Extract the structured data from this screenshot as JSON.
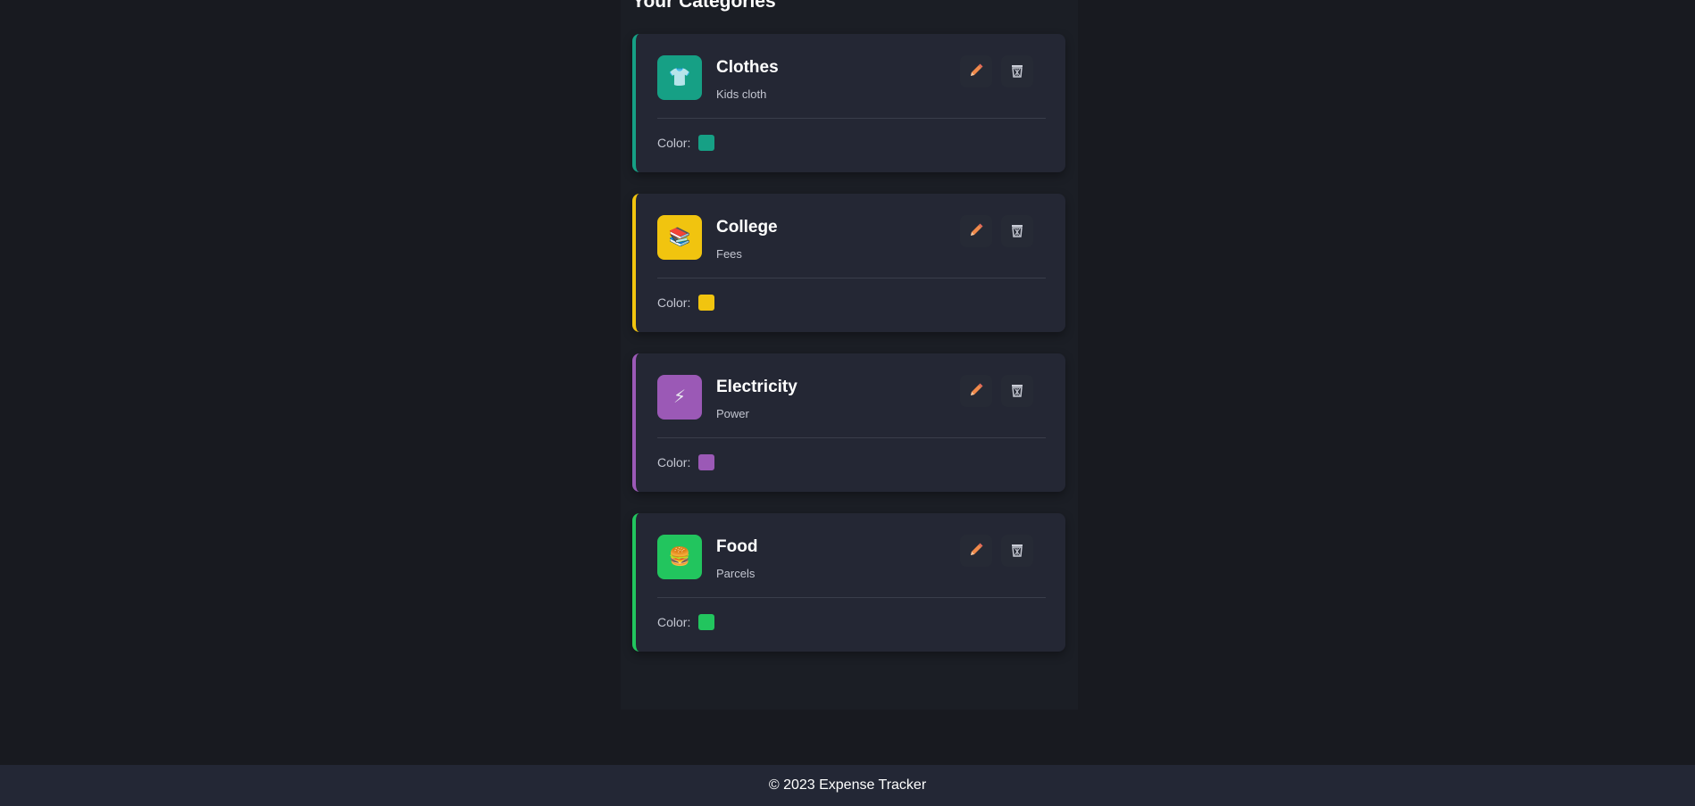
{
  "section": {
    "title": "Your Categories"
  },
  "categories": [
    {
      "name": "Clothes",
      "description": "Kids cloth",
      "color_label": "Color:",
      "color": "#16a085",
      "icon": "tshirt-icon",
      "glyph": "👕"
    },
    {
      "name": "College",
      "description": "Fees",
      "color_label": "Color:",
      "color": "#f1c40f",
      "icon": "books-icon",
      "glyph": "📚"
    },
    {
      "name": "Electricity",
      "description": "Power",
      "color_label": "Color:",
      "color": "#9b59b6",
      "icon": "lightning-icon",
      "glyph": "⚡"
    },
    {
      "name": "Food",
      "description": "Parcels",
      "color_label": "Color:",
      "color": "#22c55e",
      "icon": "burger-icon",
      "glyph": "🍔"
    }
  ],
  "actions": {
    "edit_icon": "pencil-icon",
    "delete_icon": "trash-icon"
  },
  "footer": {
    "text": "© 2023 Expense Tracker"
  }
}
